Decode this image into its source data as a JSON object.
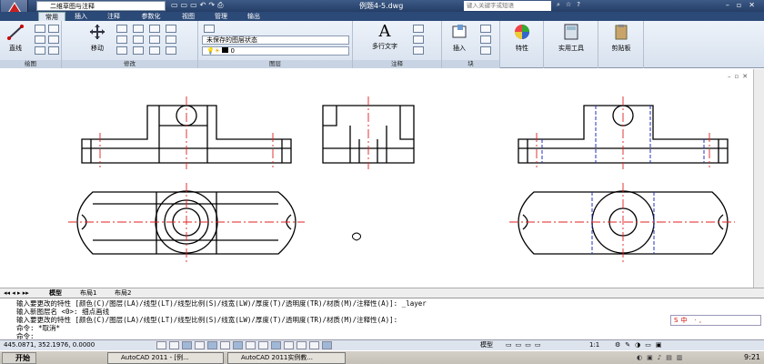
{
  "titlebar": {
    "workspace": "二维草图与注释",
    "document_title": "例题4-5.dwg",
    "search_placeholder": "键入关键字或短语"
  },
  "tabs": [
    "常用",
    "插入",
    "注释",
    "参数化",
    "视图",
    "管理",
    "输出"
  ],
  "ribbon": {
    "draw": {
      "line_label": "直线",
      "panel_label": "绘图"
    },
    "modify": {
      "move_label": "移动",
      "panel_label": "修改"
    },
    "layers": {
      "state_value": "未保存的图层状态",
      "current_layer": "0",
      "panel_label": "图层"
    },
    "annotation": {
      "text_label": "多行文字",
      "panel_label": "注释"
    },
    "block": {
      "insert_label": "插入",
      "panel_label": "块"
    },
    "properties": {
      "label": "特性"
    },
    "utilities": {
      "label": "实用工具"
    },
    "clipboard": {
      "label": "剪贴板"
    }
  },
  "layout_tabs": [
    "模型",
    "布局1",
    "布局2"
  ],
  "command": {
    "lines": [
      "输入要更改的特性 [颜色(C)/图层(LA)/线型(LT)/线型比例(S)/线宽(LW)/厚度(T)/透明度(TR)/材质(M)/注释性(A)]: _layer",
      "输入新图层名 <0>: 细点画线",
      "输入要更改的特性 [颜色(C)/图层(LA)/线型(LT)/线型比例(S)/线宽(LW)/厚度(T)/透明度(TR)/材质(M)/注释性(A)]:",
      "命令: *取消*",
      "命令:"
    ]
  },
  "ime": {
    "text": "S中 ·,"
  },
  "status": {
    "coords": "445.0871, 352.1976, 0.0000",
    "model_label": "模型",
    "scale": "1:1"
  },
  "taskbar": {
    "start": "开始",
    "items": [
      "AutoCAD 2011 - [例...",
      "AutoCAD 2011实例教..."
    ],
    "clock": "9:21"
  },
  "colors": {
    "center_line": "#e02020",
    "hidden_line": "#2030c0",
    "outline": "#000000"
  }
}
